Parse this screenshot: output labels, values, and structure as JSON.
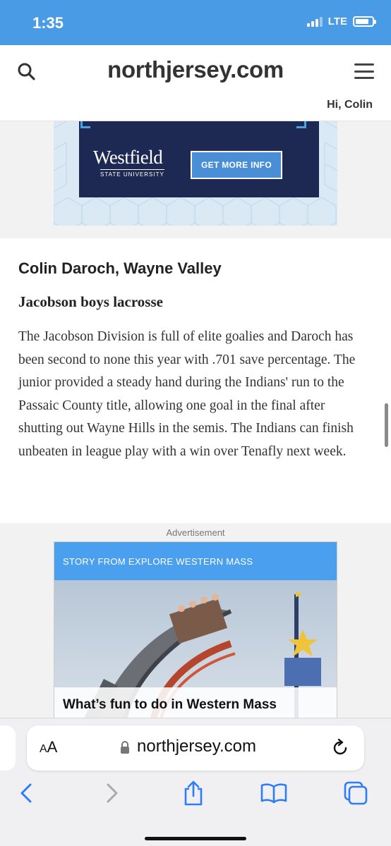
{
  "status_bar": {
    "time": "1:35",
    "network": "LTE",
    "battery_level": 0.8
  },
  "header": {
    "logo": "northjersey.com",
    "greeting": "Hi, Colin",
    "icons": [
      "search-icon",
      "menu-icon"
    ]
  },
  "top_ad": {
    "brand": "Westfield",
    "brand_sub": "STATE UNIVERSITY",
    "cta": "GET MORE INFO"
  },
  "article": {
    "player": "Colin Daroch, Wayne Valley",
    "division": "Jacobson boys lacrosse",
    "body": "The Jacobson Division is full of elite goalies and Daroch has been second to none this year with .701 save percentage. The junior provided a steady hand during the Indians' run to the Passaic County title, allowing one goal in the final after shutting out Wayne Hills in the semis. The Indians can finish unbeaten in league play with a win over Tenafly next week."
  },
  "bottom_ad": {
    "label": "Advertisement",
    "source": "STORY FROM EXPLORE WESTERN MASS",
    "headline": "What’s fun to do in Western Mass"
  },
  "safari": {
    "aa_label_big": "A",
    "aa_label_small": "A",
    "url": "northjersey.com",
    "toolbar_icons": [
      "back-icon",
      "forward-icon",
      "share-icon",
      "bookmarks-icon",
      "tabs-icon"
    ],
    "accent_color": "#2f7cf6"
  }
}
